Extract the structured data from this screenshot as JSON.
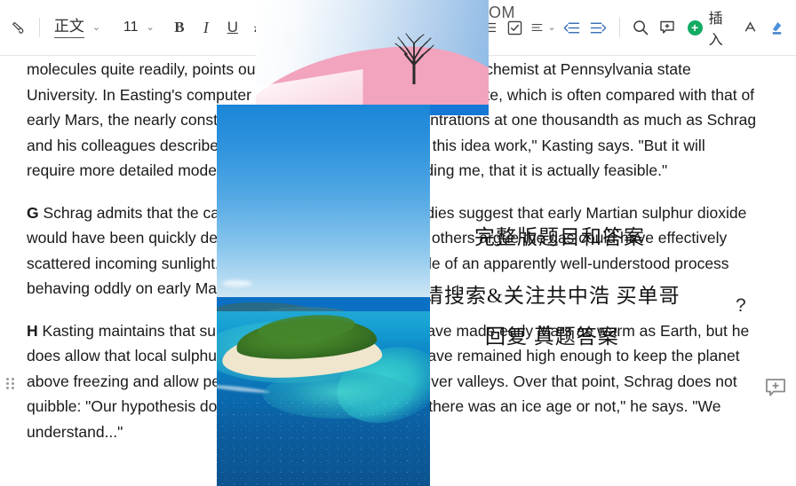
{
  "window": {
    "partial_title": "OM"
  },
  "toolbar": {
    "format_painter_label": "",
    "style": {
      "value": "正文",
      "caret": "⌄"
    },
    "font_size": {
      "value": "11",
      "caret": "⌄"
    },
    "bold_label": "B",
    "italic_label": "I",
    "underline_label": "U",
    "strikethrough_label": "A",
    "align_caret": "⌄",
    "insert_label": "插入",
    "insert_plus": "+"
  },
  "document": {
    "paragraphs": [
      {
        "id": "para-f",
        "label": "",
        "text": "molecules quite readily, points out James Kasting, an atmospheric chemist at Pennsylvania state University. In Easting's computer simulations of early Martian climate, which is often compared with that of early Mars, the nearly constant sunlight capped S02 concentrations at one thousandth as much as Schrag and his colleagues describe. \"There may be ways to make this idea work,\" Kasting says. \"But it will require more detailed modeling to convince skeptics, including me, that it is actually feasible.\""
      },
      {
        "id": "para-g",
        "label": "G",
        "text": "Schrag admits that the case is not yet closed. Some studies suggest that early Martian sulphur dioxide would have been quickly destroyed photochemically, while others argue the gas could have effectively scattered incoming sunlight. This debate is another example of an apparently well-understood process behaving oddly on early Mars."
      },
      {
        "id": "para-h",
        "label": "H",
        "text": "Kasting maintains that sulphur dioxide alone could not have made early Mars as warm as Earth, but he does allow that local sulphur dioxide concentrations may have remained high enough to keep the planet above freezing and allow perhaps enough rainfall to form river valleys. Over that point, Schrag does not quibble: \"Our hypothesis doesn't depend at all on whether there was an ice age or not,\" he says. \"We understand...\""
      }
    ]
  },
  "overlay_text": {
    "line1": "完整版题目和答案",
    "line2": "请搜索&关注共中浩  买单哥",
    "line3": "回复 真题答案",
    "cut_char": "?"
  },
  "images": [
    {
      "name": "pink-hill-tree-photo",
      "alt": "pink snow hill with bare tree and blue gradient sky"
    },
    {
      "name": "tropical-island-photo",
      "alt": "aerial view of tropical island with turquoise reef"
    }
  ],
  "colors": {
    "accent_green": "#13ab63",
    "toolbar_border": "#e6e6e6",
    "text": "#1a1a1a",
    "hill_pink": "#f2a3bd",
    "sea_blue": "#0a6cb1"
  }
}
